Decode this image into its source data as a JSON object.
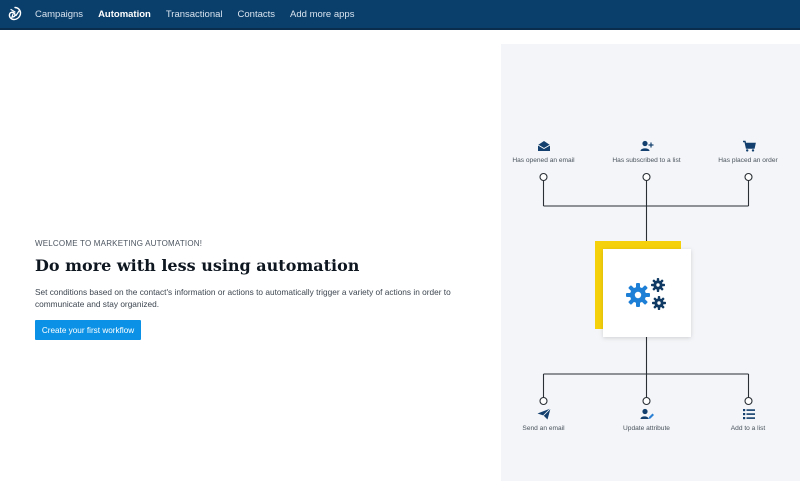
{
  "nav": {
    "items": [
      {
        "label": "Campaigns",
        "active": false
      },
      {
        "label": "Automation",
        "active": true
      },
      {
        "label": "Transactional",
        "active": false
      },
      {
        "label": "Contacts",
        "active": false
      },
      {
        "label": "Add more apps",
        "active": false
      }
    ]
  },
  "hero": {
    "eyebrow": "WELCOME TO MARKETING AUTOMATION!",
    "title": "Do more with less using automation",
    "description": "Set conditions based on the contact's information or actions to automatically trigger a variety of actions in order to communicate and stay organized.",
    "cta_label": "Create your first workflow"
  },
  "diagram": {
    "triggers": [
      {
        "label": "Has opened an email",
        "icon": "email-open-icon"
      },
      {
        "label": "Has subscribed to a list",
        "icon": "user-add-icon"
      },
      {
        "label": "Has placed an order",
        "icon": "cart-icon"
      }
    ],
    "actions": [
      {
        "label": "Send an email",
        "icon": "send-icon"
      },
      {
        "label": "Update attribute",
        "icon": "user-edit-icon"
      },
      {
        "label": "Add to a list",
        "icon": "list-icon"
      }
    ],
    "center_icon": "gears-icon"
  },
  "colors": {
    "topbar": "#0b3f6b",
    "accent": "#0b92e6",
    "highlight": "#f5d10b",
    "panel": "#f3f5f8",
    "icon": "#1f62a8"
  }
}
